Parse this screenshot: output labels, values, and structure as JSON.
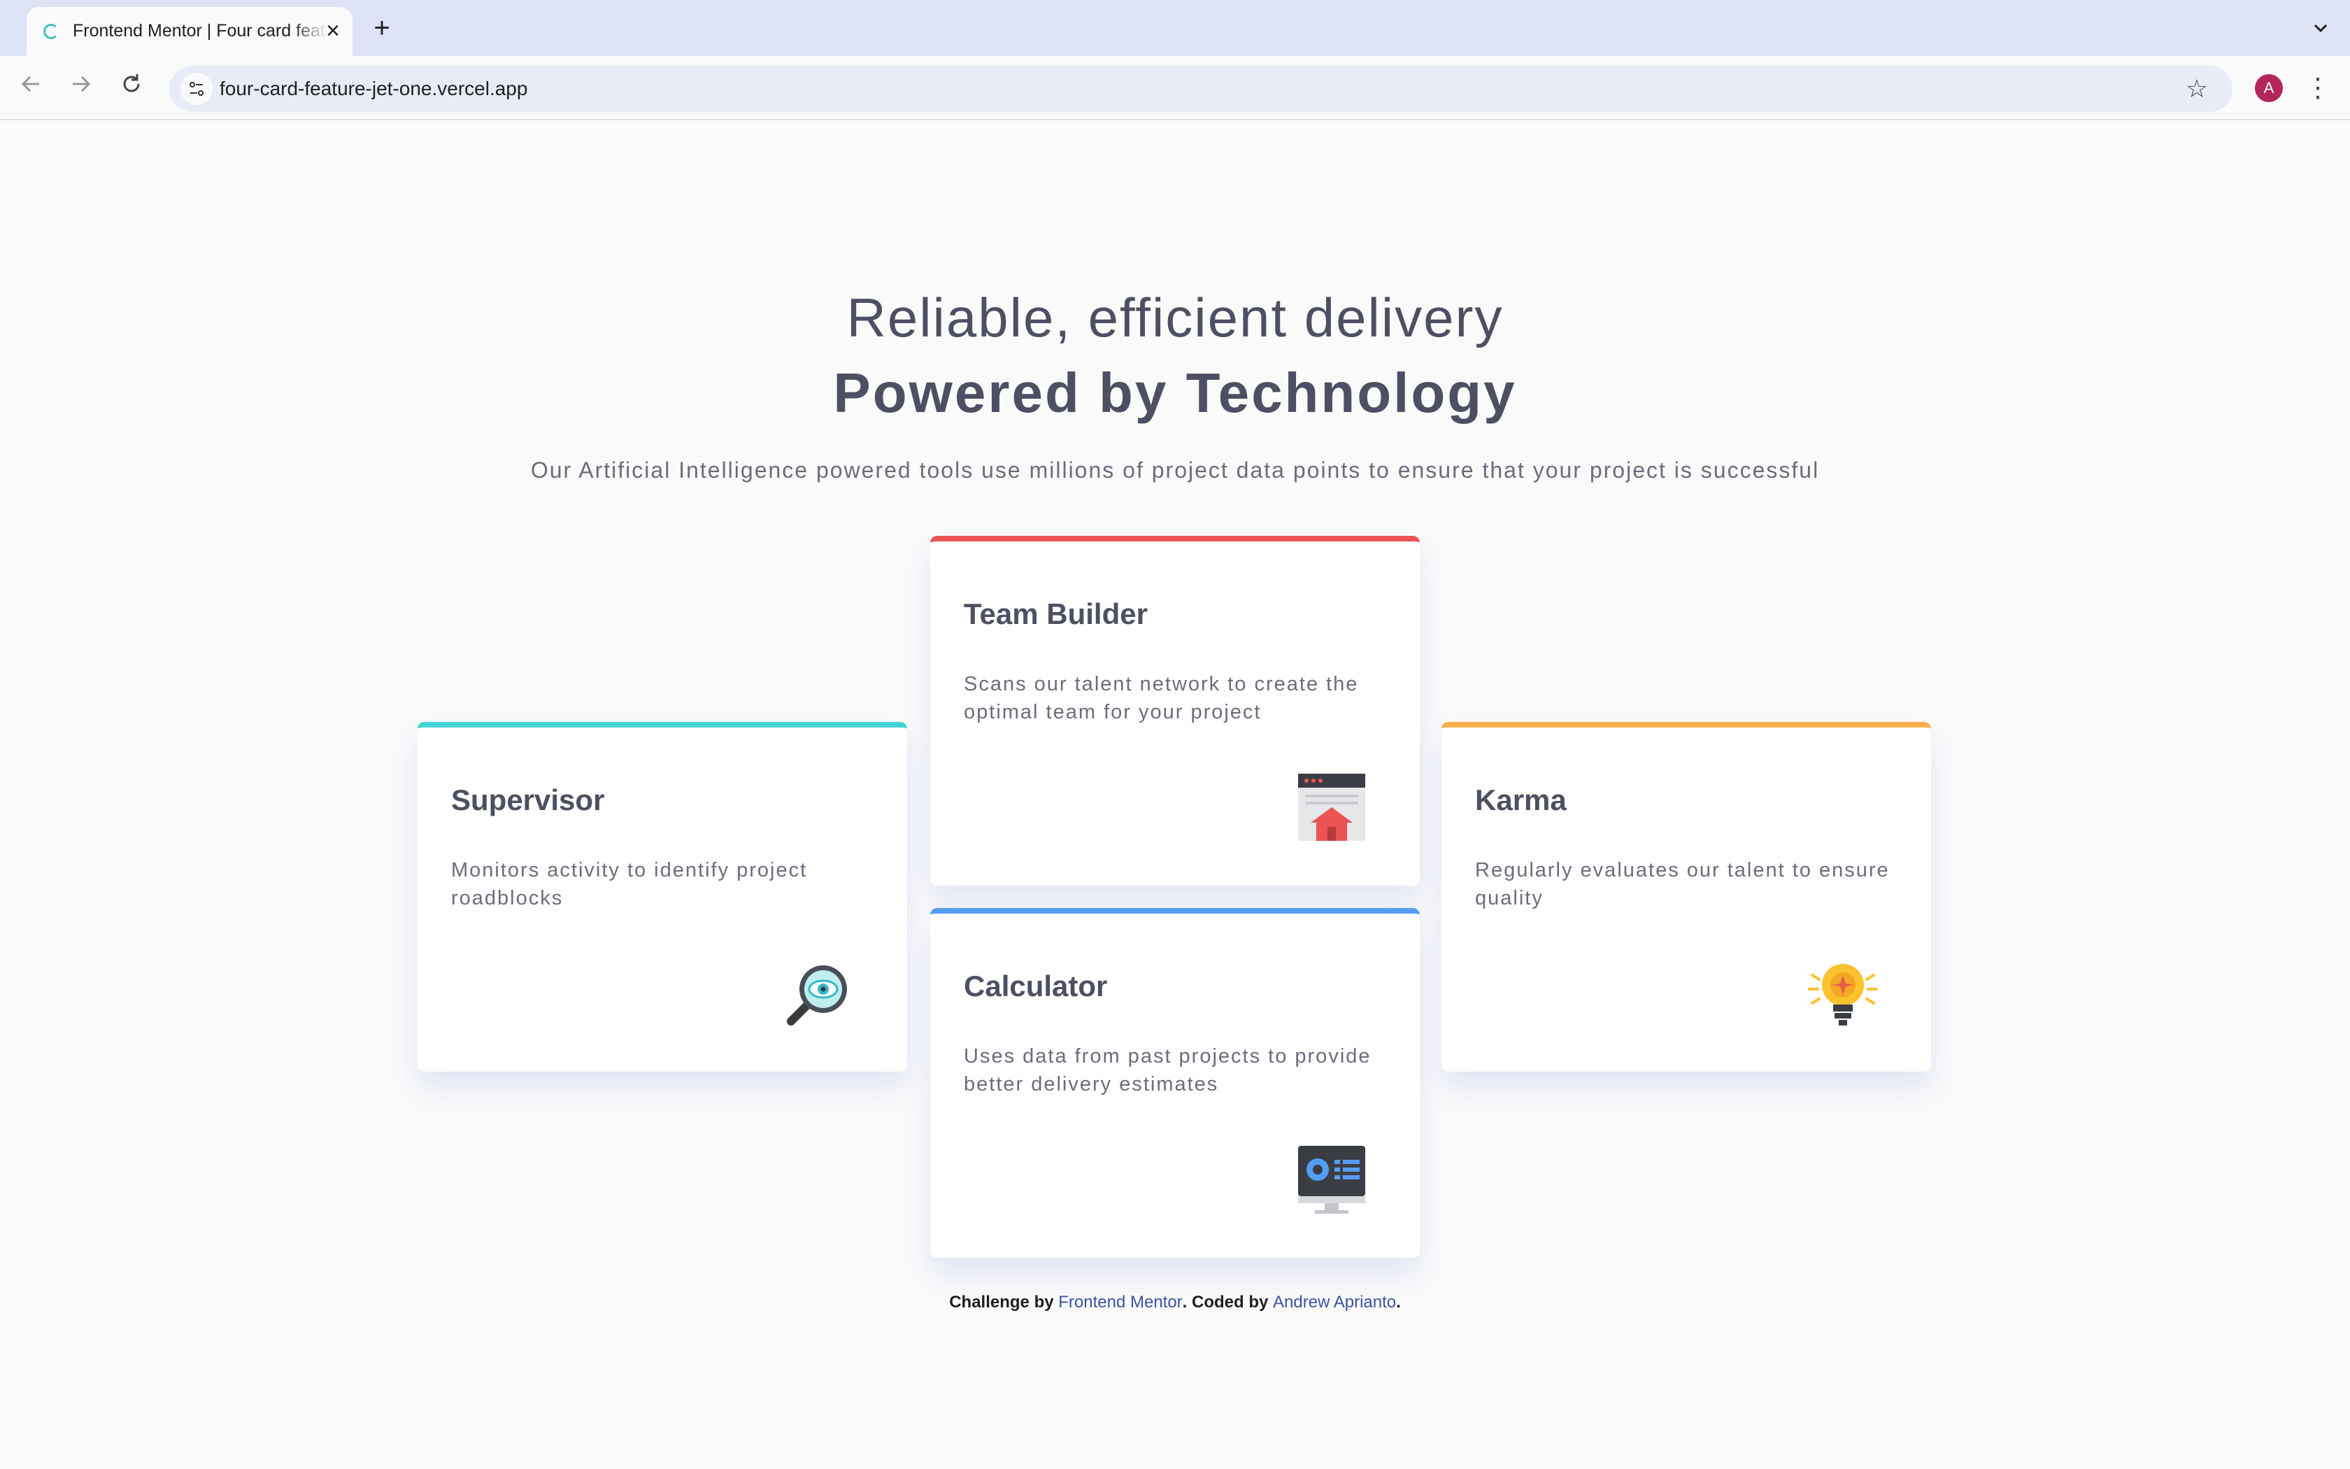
{
  "browser": {
    "tab_title": "Frontend Mentor | Four card feature section",
    "url": "four-card-feature-jet-one.vercel.app",
    "avatar_initial": "A"
  },
  "page": {
    "heading_light": "Reliable, efficient delivery",
    "heading_bold": "Powered by Technology",
    "intro": "Our Artificial Intelligence powered tools use millions of project data points to ensure that your project is successful"
  },
  "cards": {
    "supervisor": {
      "title": "Supervisor",
      "desc": "Monitors activity to identify project roadblocks",
      "accent": "#44d3d2"
    },
    "team_builder": {
      "title": "Team Builder",
      "desc": "Scans our talent network to create the optimal team for your project",
      "accent": "#ea5454"
    },
    "karma": {
      "title": "Karma",
      "desc": "Regularly evaluates our talent to ensure quality",
      "accent": "#fcaf4a"
    },
    "calculator": {
      "title": "Calculator",
      "desc": "Uses data from past projects to provide better delivery estimates",
      "accent": "#549ef2"
    }
  },
  "footer": {
    "prefix": "Challenge by",
    "challenge_link": "Frontend Mentor",
    "middle": ". Coded by",
    "author_link": "Andrew Aprianto",
    "suffix": "."
  }
}
